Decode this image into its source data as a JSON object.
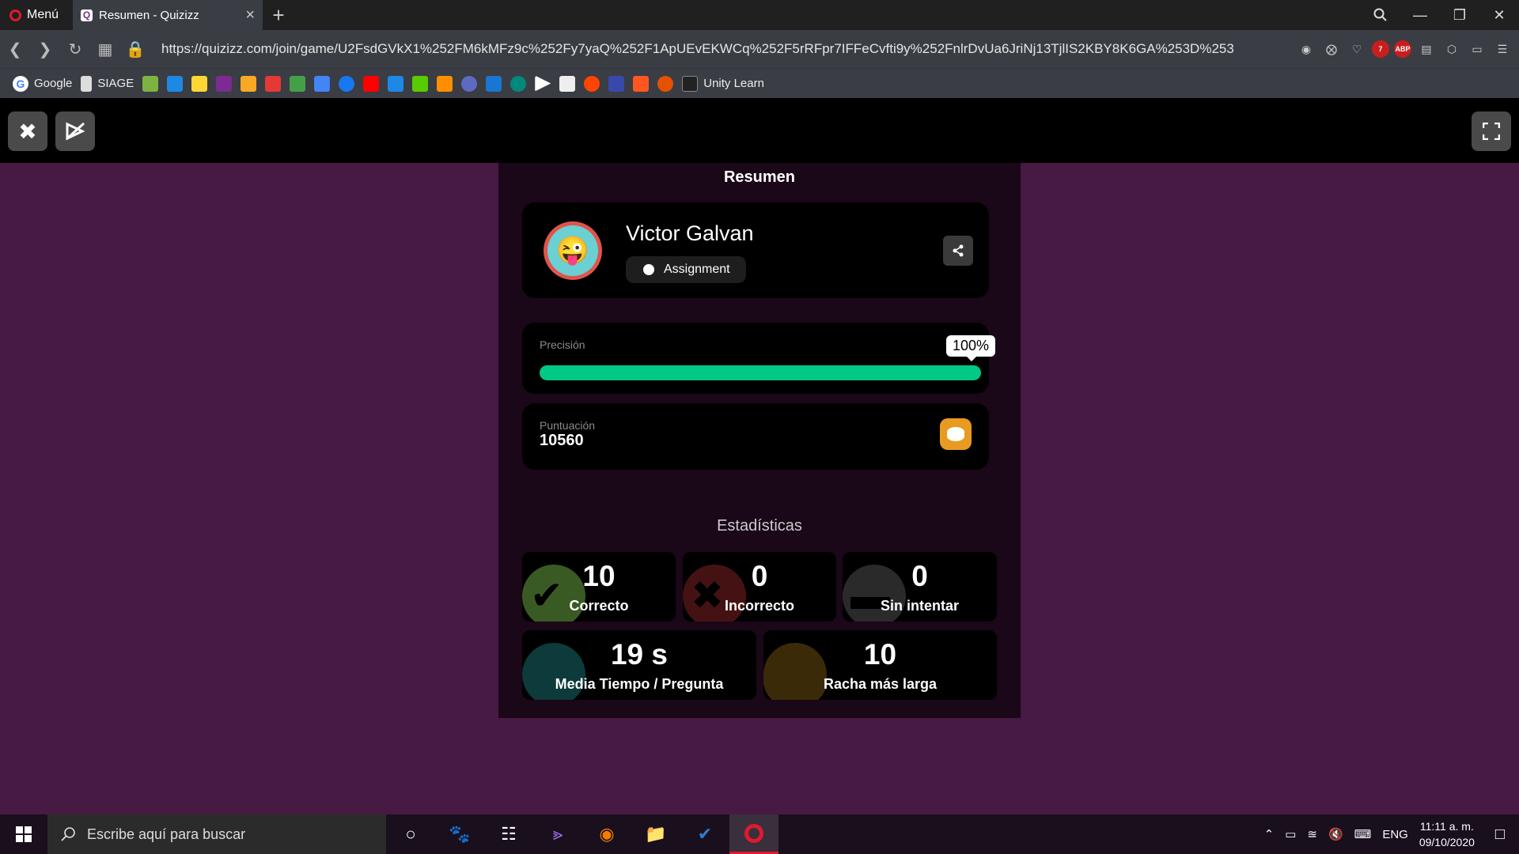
{
  "browser": {
    "menu_label": "Menú",
    "tab_title": "Resumen - Quizizz",
    "url": "https://quizizz.com/join/game/U2FsdGVkX1%252FM6kMFz9c%252Fy7yaQ%252F1ApUEvEKWCq%252F5rRFpr7IFFeCvfti9y%252FnlrDvUa6JriNj13TjlIS2KBY8K6GA%253D%253",
    "bookmarks": [
      {
        "label": "Google"
      },
      {
        "label": "SIAGE"
      },
      {
        "label": "Unity Learn"
      }
    ],
    "extension_badge": "7",
    "abp_label": "ABP"
  },
  "summary": {
    "title": "Resumen",
    "player_name": "Victor Galvan",
    "mode_badge": "Assignment",
    "accuracy_label": "Precisión",
    "accuracy_value": "100%",
    "accuracy_fraction": 1.0,
    "score_label": "Puntuación",
    "score_value": "10560"
  },
  "stats": {
    "title": "Estadísticas",
    "correct": {
      "value": "10",
      "label": "Correcto"
    },
    "incorrect": {
      "value": "0",
      "label": "Incorrecto"
    },
    "unattempted": {
      "value": "0",
      "label": "Sin intentar"
    },
    "avg_time": {
      "value": "19 s",
      "label": "Media Tiempo / Pregunta"
    },
    "streak": {
      "value": "10",
      "label": "Racha más larga"
    }
  },
  "taskbar": {
    "search_placeholder": "Escribe aquí para buscar",
    "language": "ENG",
    "time": "11:11 a. m.",
    "date": "09/10/2020"
  },
  "colors": {
    "background": "#461a42",
    "accuracy_bar": "#00c985",
    "coin": "#e89a21"
  }
}
